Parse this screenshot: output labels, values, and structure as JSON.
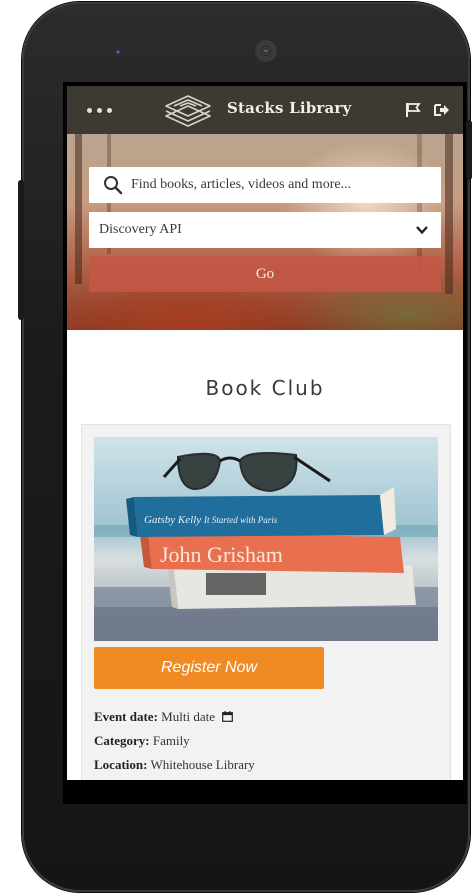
{
  "header": {
    "brand": "Stacks Library",
    "icons": [
      "more-icon",
      "logo-icon",
      "flag-icon",
      "sign-out-icon"
    ]
  },
  "search": {
    "placeholder": "Find books, articles, videos and more...",
    "source_value": "Discovery API",
    "go_label": "Go"
  },
  "page": {
    "title": "Book Club"
  },
  "event": {
    "book_spine_1": "Gatsby Kelly",
    "book_spine_1b": "It Started with Paris",
    "book_spine_2": "John Grisham",
    "register_label": "Register Now",
    "date_label": "Event date:",
    "date_value": "Multi date",
    "category_label": "Category:",
    "category_value": "Family",
    "location_label": "Location:",
    "location_value": "Whitehouse Library"
  },
  "colors": {
    "header_bg": "#3d3933",
    "go_button": "#c45646",
    "register_button": "#f08a24"
  }
}
